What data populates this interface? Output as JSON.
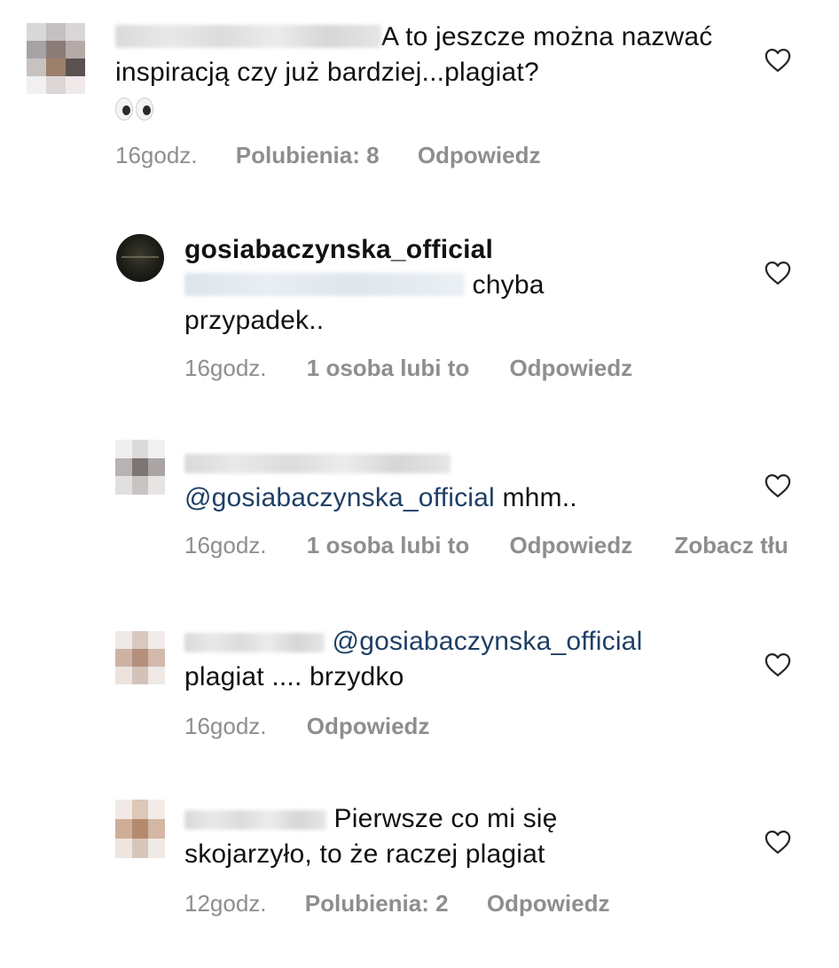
{
  "comments": [
    {
      "text": "A to jeszcze można nazwać inspiracją czy już bardziej...plagiat?",
      "emoji_icon": "eyes-emoji",
      "time": "16godz.",
      "likes": "Polubienia: 8",
      "reply": "Odpowiedz"
    },
    {
      "username": "gosiabaczynska_official",
      "text_line1": "chyba",
      "text_line2": "przypadek..",
      "time": "16godz.",
      "likes": "1 osoba lubi to",
      "reply": "Odpowiedz"
    },
    {
      "mention": "@gosiabaczynska_official",
      "text": "mhm..",
      "time": "16godz.",
      "likes": "1 osoba lubi to",
      "reply": "Odpowiedz",
      "thread": "Zobacz tłu"
    },
    {
      "mention": "@gosiabaczynska_official",
      "text": "plagiat .... brzydko",
      "time": "16godz.",
      "reply": "Odpowiedz"
    },
    {
      "text_line1": "Pierwsze co mi się",
      "text_line2": "skojarzyło, to że raczej plagiat",
      "time": "12godz.",
      "likes": "Polubienia: 2",
      "reply": "Odpowiedz"
    }
  ],
  "icons": {
    "like": "heart-outline-icon"
  },
  "colors": {
    "meta_text": "#8e8e8e",
    "mention": "#1f3f66",
    "body_text": "#111111"
  }
}
